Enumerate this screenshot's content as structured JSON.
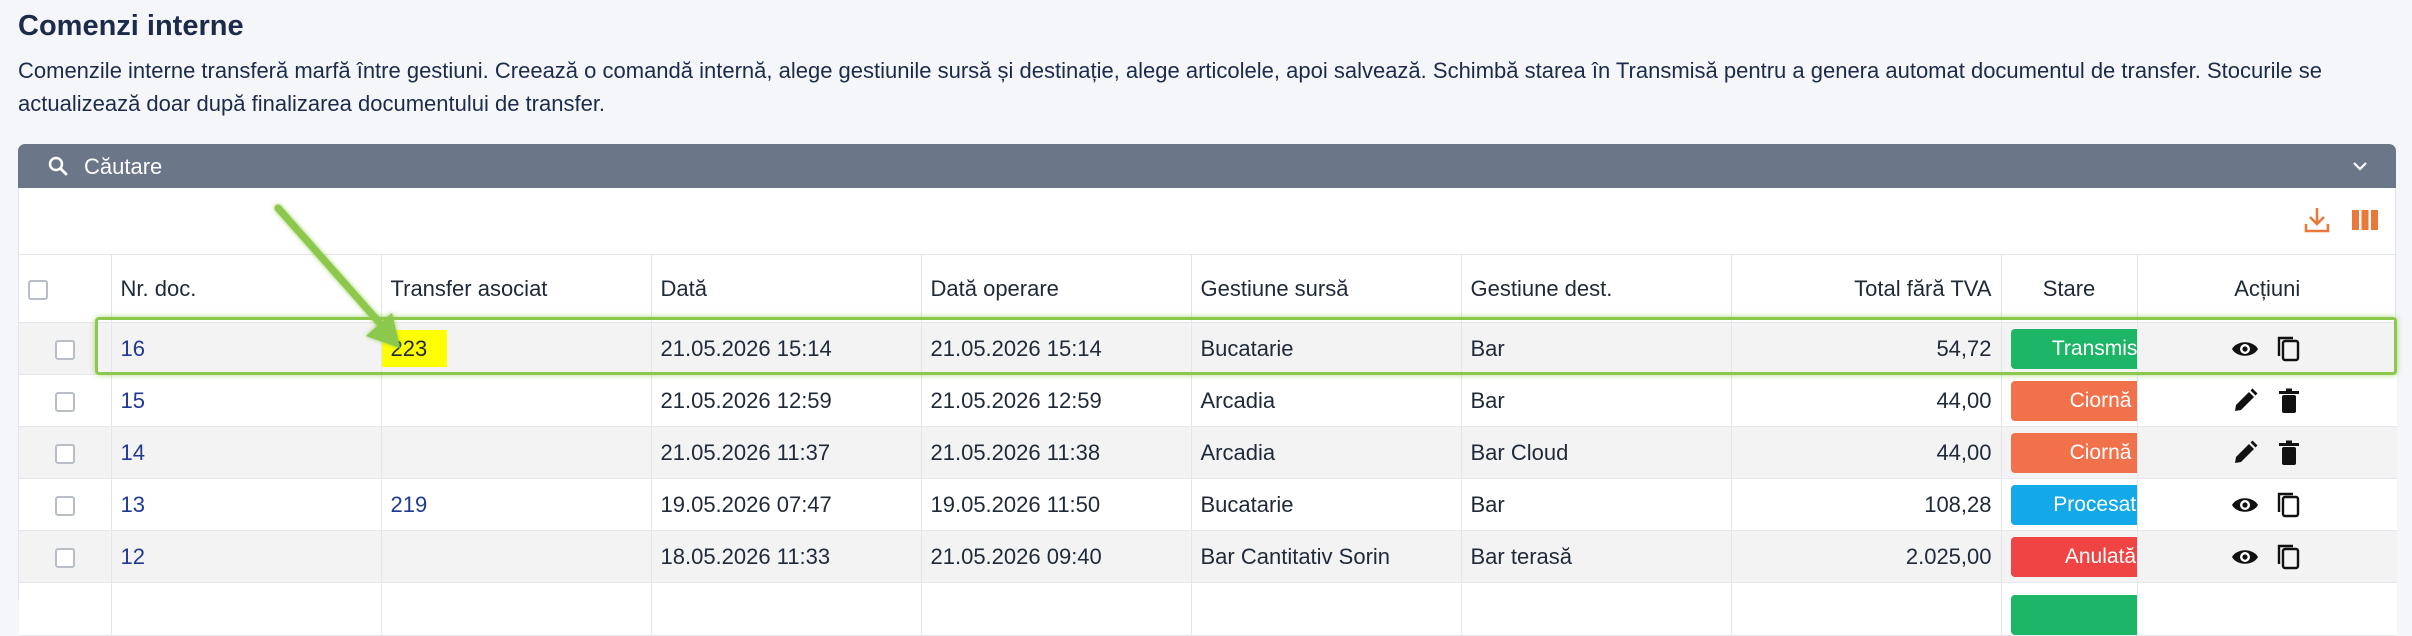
{
  "page": {
    "title": "Comenzi interne",
    "description": "Comenzile interne transferă marfă între gestiuni. Creează o comandă internă, alege gestiunile sursă și destinație, alege articolele, apoi salvează. Schimbă starea în Transmisă pentru a genera automat documentul de transfer. Stocurile se actualizează doar după finalizarea documentului de transfer."
  },
  "search": {
    "label": "Căutare"
  },
  "toolbar": {
    "download_icon": "download-icon",
    "columns_icon": "columns-icon"
  },
  "colors": {
    "accent_orange": "#e8793a",
    "header_bar": "#6b7689",
    "status_transmisa": "#1db566",
    "status_ciorna": "#f0714a",
    "status_procesata": "#13a9e8",
    "status_anulata": "#f04444",
    "highlight": "#ffff00",
    "annotation": "#8cc84b"
  },
  "table": {
    "headers": {
      "nr_doc": "Nr. doc.",
      "transfer": "Transfer asociat",
      "data": "Dată",
      "data_operare": "Dată operare",
      "sursa": "Gestiune sursă",
      "dest": "Gestiune dest.",
      "total": "Total fără TVA",
      "stare": "Stare",
      "actiuni": "Acțiuni"
    },
    "rows": [
      {
        "nr": "16",
        "transfer": "223",
        "data": "21.05.2026 15:14",
        "operare": "21.05.2026 15:14",
        "sursa": "Bucatarie",
        "dest": "Bar",
        "total": "54,72",
        "stare": "Transmisă"
      },
      {
        "nr": "15",
        "transfer": "",
        "data": "21.05.2026 12:59",
        "operare": "21.05.2026 12:59",
        "sursa": "Arcadia",
        "dest": "Bar",
        "total": "44,00",
        "stare": "Ciornă"
      },
      {
        "nr": "14",
        "transfer": "",
        "data": "21.05.2026 11:37",
        "operare": "21.05.2026 11:38",
        "sursa": "Arcadia",
        "dest": "Bar Cloud",
        "total": "44,00",
        "stare": "Ciornă"
      },
      {
        "nr": "13",
        "transfer": "219",
        "data": "19.05.2026 07:47",
        "operare": "19.05.2026 11:50",
        "sursa": "Bucatarie",
        "dest": "Bar",
        "total": "108,28",
        "stare": "Procesată"
      },
      {
        "nr": "12",
        "transfer": "",
        "data": "18.05.2026 11:33",
        "operare": "21.05.2026 09:40",
        "sursa": "Bar Cantitativ Sorin",
        "dest": "Bar terasă",
        "total": "2.025,00",
        "stare": "Anulată"
      }
    ]
  }
}
